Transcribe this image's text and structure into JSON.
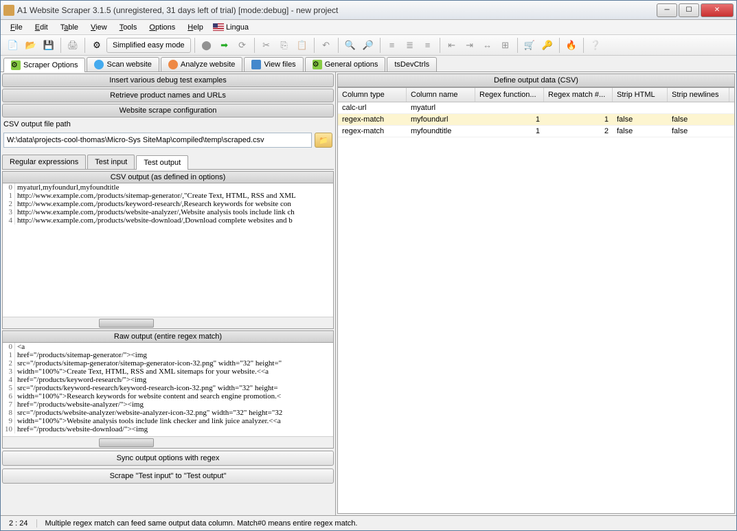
{
  "window": {
    "title": "A1 Website Scraper 3.1.5 (unregistered, 31 days left of trial) [mode:debug] - new project"
  },
  "menu": {
    "file": "File",
    "edit": "Edit",
    "table": "Table",
    "view": "View",
    "tools": "Tools",
    "options": "Options",
    "help": "Help",
    "lingua": "Lingua"
  },
  "toolbar": {
    "simplified": "Simplified easy mode"
  },
  "maintabs": [
    {
      "label": "Scraper Options"
    },
    {
      "label": "Scan website"
    },
    {
      "label": "Analyze website"
    },
    {
      "label": "View files"
    },
    {
      "label": "General options"
    },
    {
      "label": "tsDevCtrls"
    }
  ],
  "left": {
    "bar1": "Insert various debug test examples",
    "bar2": "Retrieve product names and URLs",
    "bar3": "Website scrape configuration",
    "csvlabel": "CSV output file path",
    "csvpath": "W:\\data\\projects-cool-thomas\\Micro-Sys SiteMap\\compiled\\temp\\scraped.csv",
    "subtabs": {
      "regex": "Regular expressions",
      "testin": "Test input",
      "testout": "Test output"
    },
    "csvout_hdr": "CSV output (as defined in options)",
    "csvout": [
      "myaturl,myfoundurl,myfoundtitle",
      "http://www.example.com,/products/sitemap-generator/,\"Create Text, HTML, RSS and XML",
      "http://www.example.com,/products/keyword-research/,Research keywords for website con",
      "http://www.example.com,/products/website-analyzer/,Website analysis tools include link ch",
      "http://www.example.com,/products/website-download/,Download complete websites and b"
    ],
    "rawout_hdr": "Raw output (entire regex match)",
    "rawout": [
      "<a",
      "href=\"/products/sitemap-generator/\"><img",
      "src=\"/products/sitemap-generator/sitemap-generator-icon-32.png\" width=\"32\" height=\"",
      "width=\"100%\">Create Text, HTML, RSS and XML sitemaps for your website.<<a",
      "href=\"/products/keyword-research/\"><img",
      "src=\"/products/keyword-research/keyword-research-icon-32.png\" width=\"32\" height=",
      "width=\"100%\">Research keywords for website content and search engine promotion.<",
      "href=\"/products/website-analyzer/\"><img",
      "src=\"/products/website-analyzer/website-analyzer-icon-32.png\" width=\"32\" height=\"32",
      "width=\"100%\">Website analysis tools include link checker and link juice analyzer.<<a",
      "href=\"/products/website-download/\"><img"
    ],
    "syncbtn": "Sync output options with regex",
    "scrapebtn": "Scrape \"Test input\" to \"Test output\""
  },
  "right": {
    "hdr": "Define output data (CSV)",
    "cols": [
      "Column type",
      "Column name",
      "Regex function...",
      "Regex match #...",
      "Strip HTML",
      "Strip newlines"
    ],
    "rows": [
      {
        "type": "calc-url",
        "name": "myaturl",
        "fn": "",
        "match": "",
        "strip": "",
        "newl": "",
        "sel": false
      },
      {
        "type": "regex-match",
        "name": "myfoundurl",
        "fn": "1",
        "match": "1",
        "strip": "false",
        "newl": "false",
        "sel": true
      },
      {
        "type": "regex-match",
        "name": "myfoundtitle",
        "fn": "1",
        "match": "2",
        "strip": "false",
        "newl": "false",
        "sel": false
      }
    ]
  },
  "status": {
    "pos": "2 : 24",
    "msg": "Multiple regex match can feed same output data column. Match#0 means entire regex match."
  }
}
